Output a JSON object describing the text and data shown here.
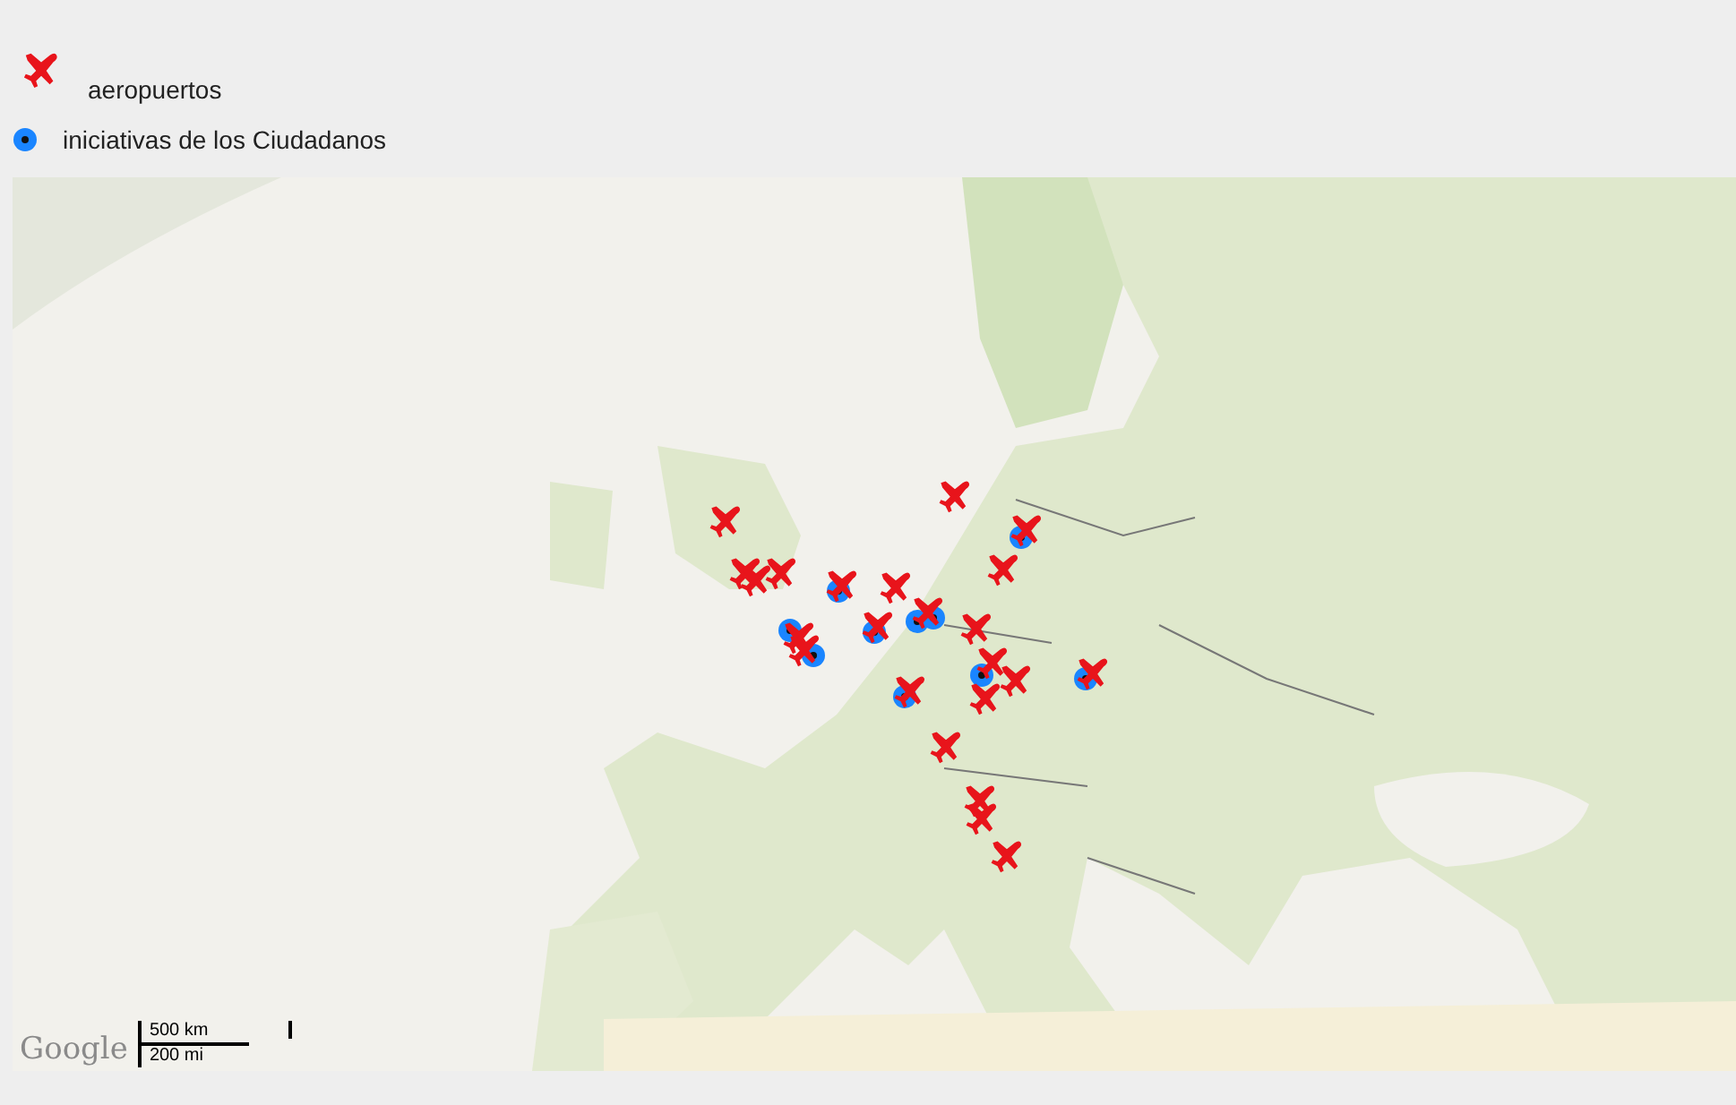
{
  "legend": [
    {
      "kind": "airport",
      "label": "aeropuertos"
    },
    {
      "kind": "initiative",
      "label": "iniciativas de los Ciudadanos"
    }
  ],
  "map": {
    "logo": "Google",
    "scale": {
      "metric": "500 km",
      "imperial": "200 mi"
    }
  }
}
